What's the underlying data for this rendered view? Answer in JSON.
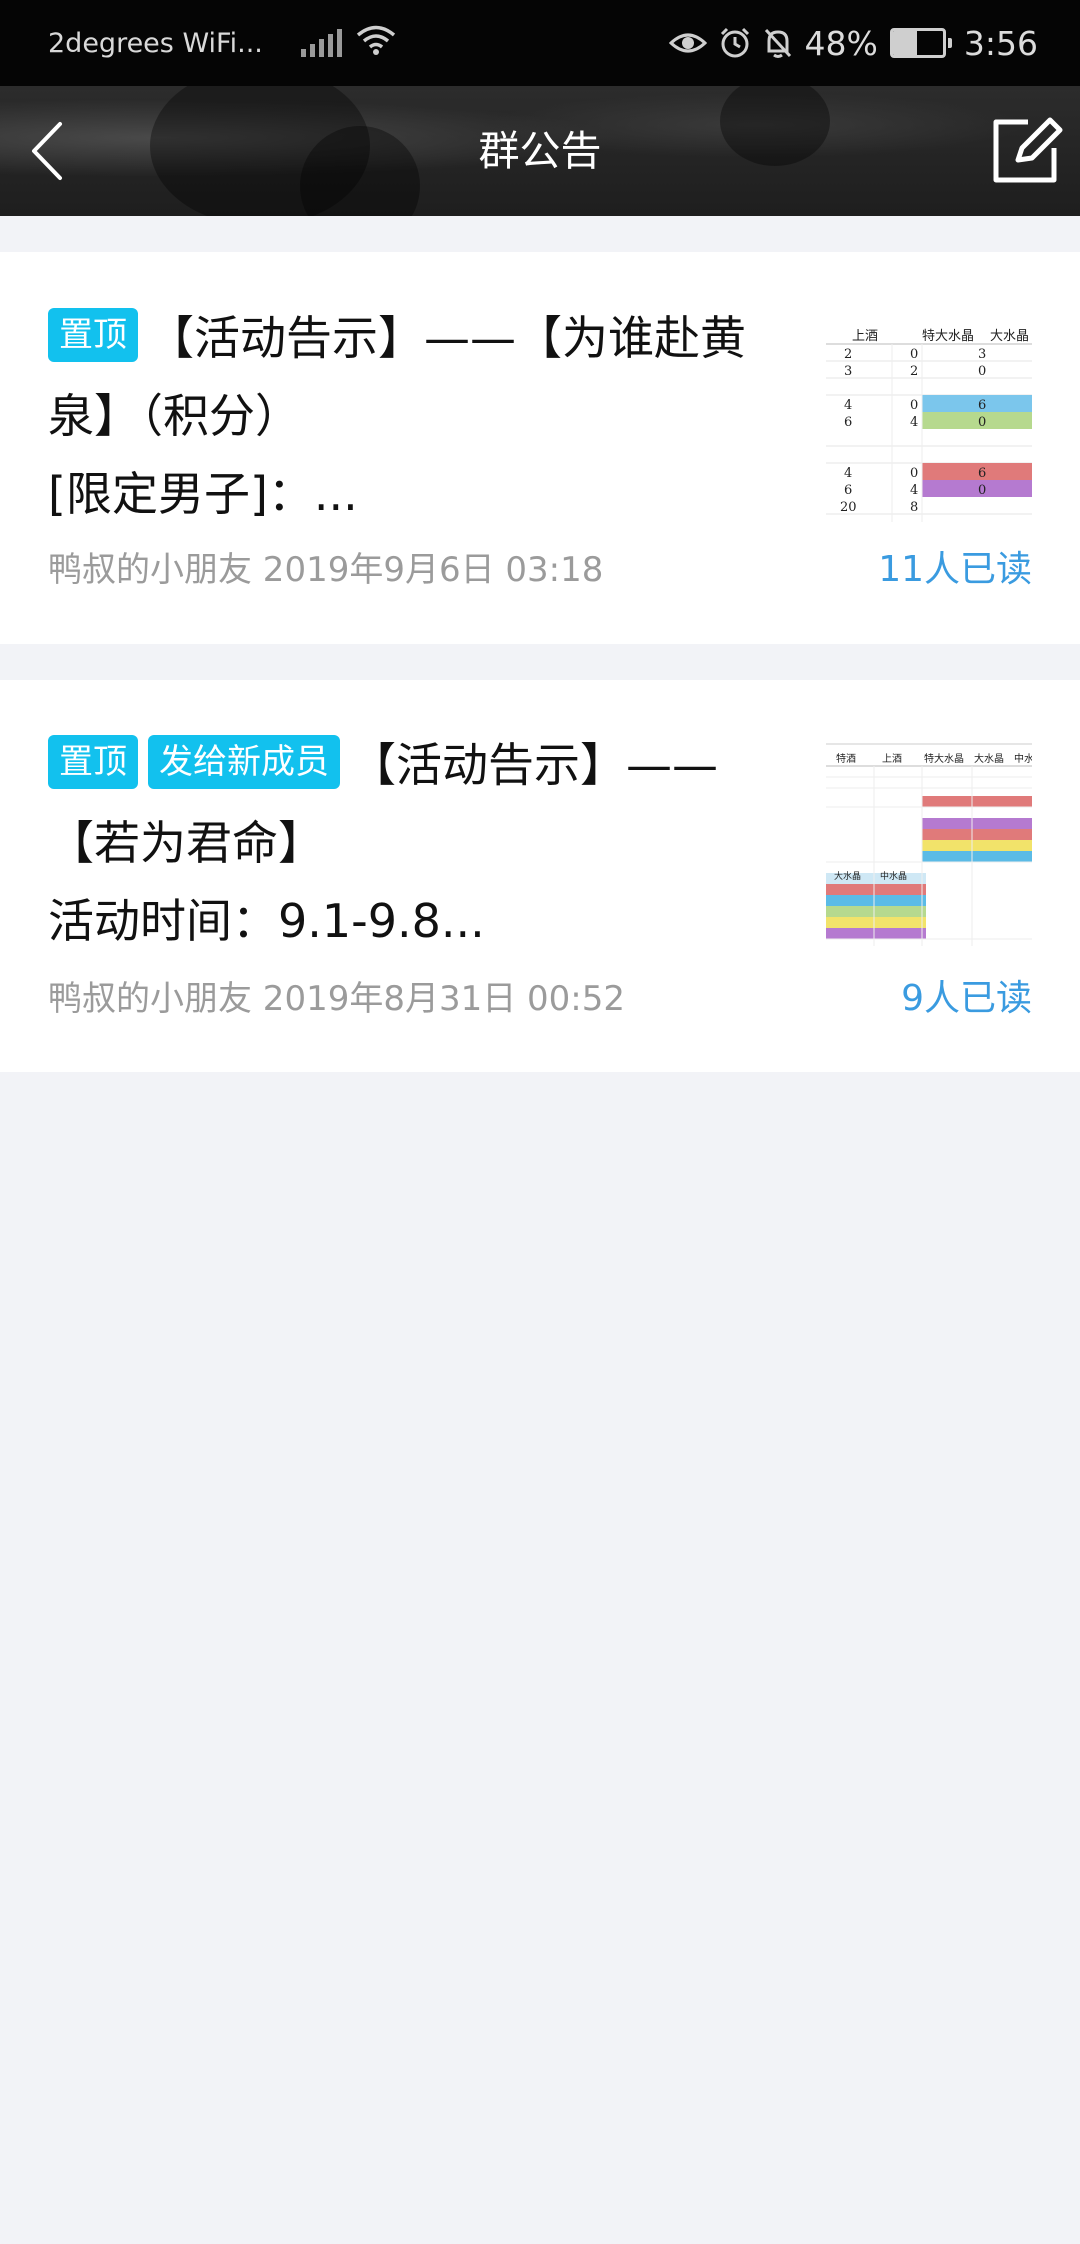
{
  "status_bar": {
    "carrier": "2degrees WiFi...",
    "battery_percent": "48%",
    "battery_level": 0.48,
    "time": "3:56",
    "icons": [
      "signal-icon",
      "wifi-icon",
      "eye-icon",
      "alarm-icon",
      "mute-bell-icon",
      "battery-icon"
    ]
  },
  "nav": {
    "title": "群公告",
    "back_icon": "back-chevron-icon",
    "edit_icon": "edit-icon"
  },
  "announcements": [
    {
      "tags": [
        "置顶"
      ],
      "title_line1": "【活动告示】——【为谁赴黄",
      "title_line2": "泉】（积分）",
      "title_line3": "[限定男子]：...",
      "author_date": "鸭叔的小朋友 2019年9月6日 03:18",
      "read_count": "11人已读",
      "thumbnail": {
        "headers": [
          "上酒",
          "特大水晶",
          "大水晶"
        ],
        "rows": [
          [
            "2",
            "0",
            "3"
          ],
          [
            "3",
            "2",
            "0"
          ],
          [
            "4",
            "0",
            "6"
          ],
          [
            "6",
            "4",
            "0"
          ],
          [
            "4",
            "0",
            "6"
          ],
          [
            "6",
            "4",
            "0"
          ],
          [
            "20",
            "8",
            ""
          ]
        ]
      }
    },
    {
      "tags": [
        "置顶",
        "发给新成员"
      ],
      "title_line1": "【活动告示】——",
      "title_line2": "【若为君命】",
      "title_line3": "活动时间：9.1-9.8...",
      "author_date": "鸭叔的小朋友 2019年8月31日 00:52",
      "read_count": "9人已读",
      "thumbnail": {
        "headers": [
          "特酒",
          "上酒",
          "特大水晶",
          "大水晶",
          "中水"
        ],
        "sub_headers": [
          "大水晶",
          "中水晶"
        ]
      }
    }
  ],
  "colors": {
    "tag_bg": "#12c1ee",
    "read_link": "#3a9be0",
    "meta_text": "#9b9b9b",
    "page_bg": "#f2f3f7"
  }
}
